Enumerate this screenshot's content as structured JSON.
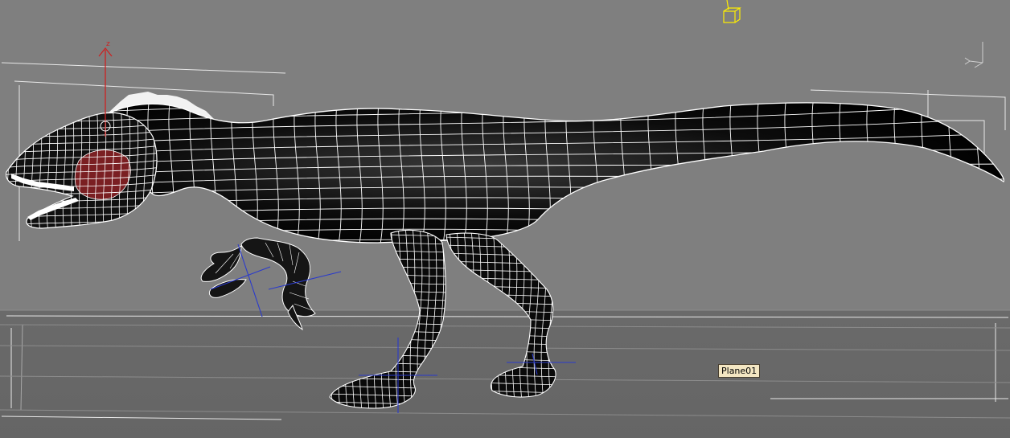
{
  "viewport": {
    "tooltip_label": "Plane01",
    "gizmo_axis_label": "z"
  },
  "colors": {
    "background": "#7f7f7f",
    "ground": "#676767",
    "mesh_wire": "#ffffff",
    "mesh_fill": "#050505",
    "gizmo_z_axis": "#cc2222",
    "bone_cross": "#2233cc",
    "light_selected": "#ffee00",
    "mouth": "#7a1f22"
  },
  "icons": {
    "light_helper": "light-icon",
    "axis_tripod": "axis-tripod-icon"
  }
}
